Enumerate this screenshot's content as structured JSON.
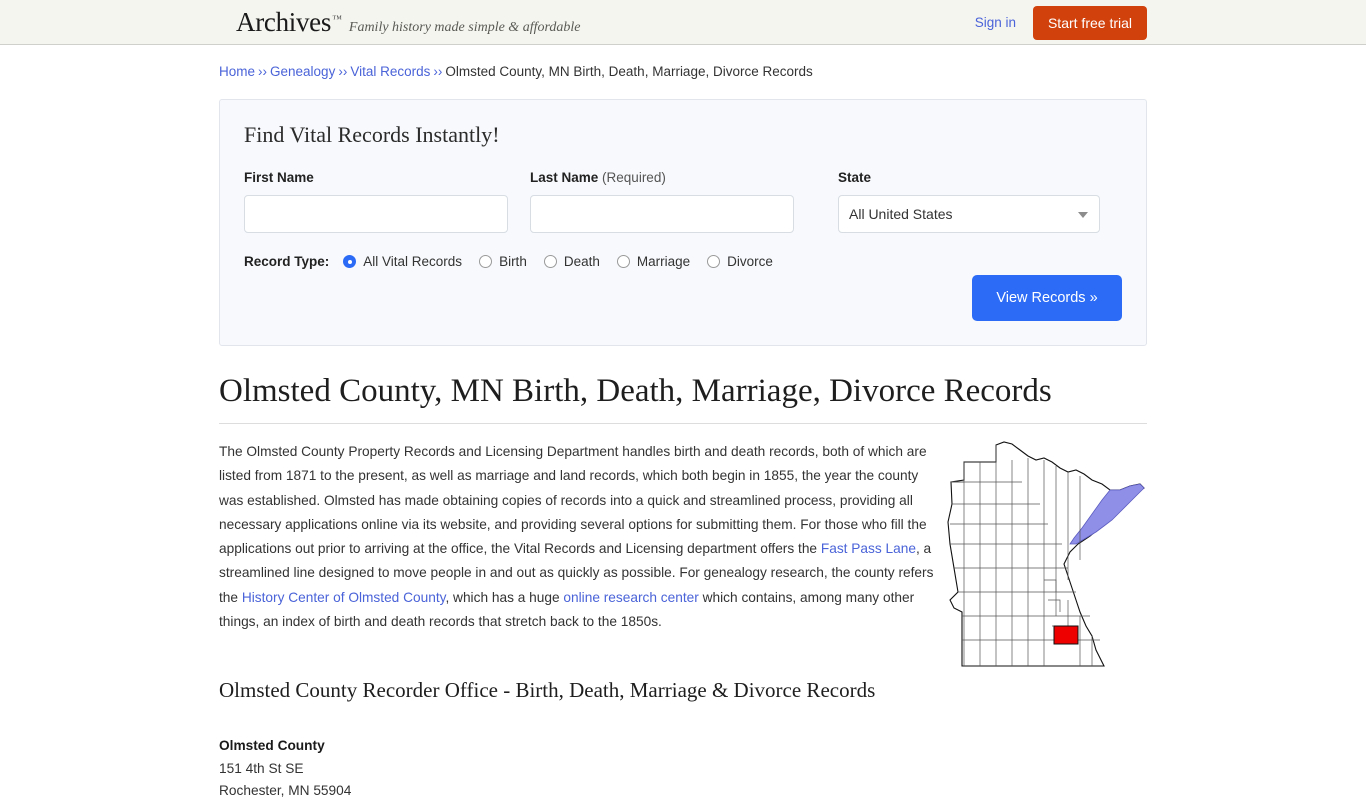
{
  "header": {
    "brand": "Archives",
    "trademark": "™",
    "tagline": "Family history made simple & affordable",
    "sign_in": "Sign in",
    "start_trial": "Start free trial",
    "trial_color": "#d1410c",
    "link_color": "#4a63d8",
    "background": "#f5f5f0"
  },
  "breadcrumb": {
    "separator": "››",
    "items": [
      {
        "label": "Home",
        "link": true
      },
      {
        "label": "Genealogy",
        "link": true
      },
      {
        "label": "Vital Records",
        "link": true
      },
      {
        "label": "Olmsted County, MN Birth, Death, Marriage, Divorce Records",
        "link": false
      }
    ]
  },
  "search": {
    "title": "Find Vital Records Instantly!",
    "first_name": {
      "label": "First Name",
      "value": "",
      "placeholder": ""
    },
    "last_name": {
      "label": "Last Name",
      "required_note": "(Required)",
      "value": "",
      "placeholder": ""
    },
    "state": {
      "label": "State",
      "selected": "All United States"
    },
    "record_type": {
      "label": "Record Type:",
      "options": [
        {
          "label": "All Vital Records",
          "selected": true
        },
        {
          "label": "Birth",
          "selected": false
        },
        {
          "label": "Death",
          "selected": false
        },
        {
          "label": "Marriage",
          "selected": false
        },
        {
          "label": "Divorce",
          "selected": false
        }
      ]
    },
    "submit_label": "View Records »",
    "submit_color": "#2b6bf5",
    "panel_background": "#f7f9fc"
  },
  "main": {
    "title": "Olmsted County, MN Birth, Death, Marriage, Divorce Records",
    "paragraph": {
      "part1": "The Olmsted County Property Records and Licensing Department handles birth and death records, both of which are listed from 1871 to the present, as well as marriage and land records, which both begin in 1855, the year the county was established. Olmsted has made obtaining copies of records into a quick and streamlined process, providing all necessary applications online via its website, and providing several options for submitting them. For those who fill the applications out prior to arriving at the office, the Vital Records and Licensing department offers the ",
      "link1": "Fast Pass Lane",
      "part2": ", a streamlined line designed to move people in and out as quickly as possible. For genealogy research, the county refers the ",
      "link2": "History Center of Olmsted County",
      "part3": ", which has a huge ",
      "link3": "online research center",
      "part4": " which contains, among many other things, an index of birth and death records that stretch back to the 1850s."
    },
    "map": {
      "state": "Minnesota",
      "highlighted_county": "Olmsted County",
      "highlight_color": "#ee0000",
      "water_color": "#8f8fe8"
    },
    "section_title": "Olmsted County Recorder Office - Birth, Death, Marriage & Divorce Records",
    "address": {
      "org": "Olmsted County",
      "street": "151 4th St SE",
      "city_state_zip": "Rochester, MN 55904"
    }
  }
}
